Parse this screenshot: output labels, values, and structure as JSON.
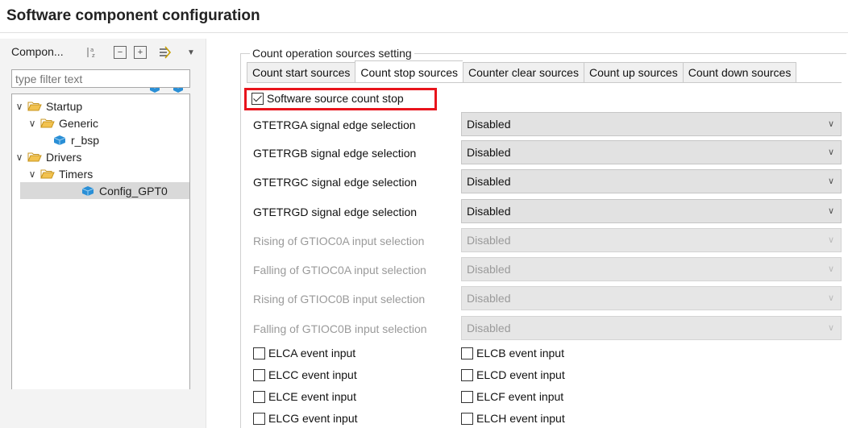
{
  "page": {
    "title": "Software component configuration"
  },
  "left": {
    "header_label": "Compon...",
    "toolbar_icons": [
      "sort-az-icon",
      "collapse-all-icon",
      "expand-all-icon",
      "link-menu-icon"
    ],
    "filter_placeholder": "type filter text",
    "tree": [
      {
        "label": "Startup",
        "level": 0,
        "type": "folder",
        "expanded": true
      },
      {
        "label": "Generic",
        "level": 1,
        "type": "folder",
        "expanded": true
      },
      {
        "label": "r_bsp",
        "level": 2,
        "type": "component"
      },
      {
        "label": "Drivers",
        "level": 0,
        "type": "folder",
        "expanded": true
      },
      {
        "label": "Timers",
        "level": 1,
        "type": "folder",
        "expanded": true
      },
      {
        "label": "Config_GPT0",
        "level": 2,
        "type": "component",
        "selected": true
      }
    ]
  },
  "right": {
    "group_title": "Count operation sources setting",
    "tabs": [
      {
        "label": "Count start sources",
        "active": false
      },
      {
        "label": "Count stop sources",
        "active": true
      },
      {
        "label": "Counter clear sources",
        "active": false
      },
      {
        "label": "Count up sources",
        "active": false
      },
      {
        "label": "Count down sources",
        "active": false
      }
    ],
    "software_stop": {
      "label": "Software source count stop",
      "checked": true
    },
    "fields": [
      {
        "label": "GTETRGA signal edge selection",
        "value": "Disabled",
        "enabled": true
      },
      {
        "label": "GTETRGB signal edge selection",
        "value": "Disabled",
        "enabled": true
      },
      {
        "label": "GTETRGC signal edge selection",
        "value": "Disabled",
        "enabled": true
      },
      {
        "label": "GTETRGD signal edge selection",
        "value": "Disabled",
        "enabled": true
      },
      {
        "label": "Rising of GTIOC0A input selection",
        "value": "Disabled",
        "enabled": false
      },
      {
        "label": "Falling of GTIOC0A input selection",
        "value": "Disabled",
        "enabled": false
      },
      {
        "label": "Rising of GTIOC0B input selection",
        "value": "Disabled",
        "enabled": false
      },
      {
        "label": "Falling of GTIOC0B input selection",
        "value": "Disabled",
        "enabled": false
      }
    ],
    "events": [
      {
        "label": "ELCA event input",
        "checked": false
      },
      {
        "label": "ELCB event input",
        "checked": false
      },
      {
        "label": "ELCC event input",
        "checked": false
      },
      {
        "label": "ELCD event input",
        "checked": false
      },
      {
        "label": "ELCE event input",
        "checked": false
      },
      {
        "label": "ELCF event input",
        "checked": false
      },
      {
        "label": "ELCG event input",
        "checked": false
      },
      {
        "label": "ELCH event input",
        "checked": false
      }
    ]
  },
  "colors": {
    "highlight": "#e8141c",
    "folder": "#e8b23c",
    "component": "#2a8fd6"
  }
}
